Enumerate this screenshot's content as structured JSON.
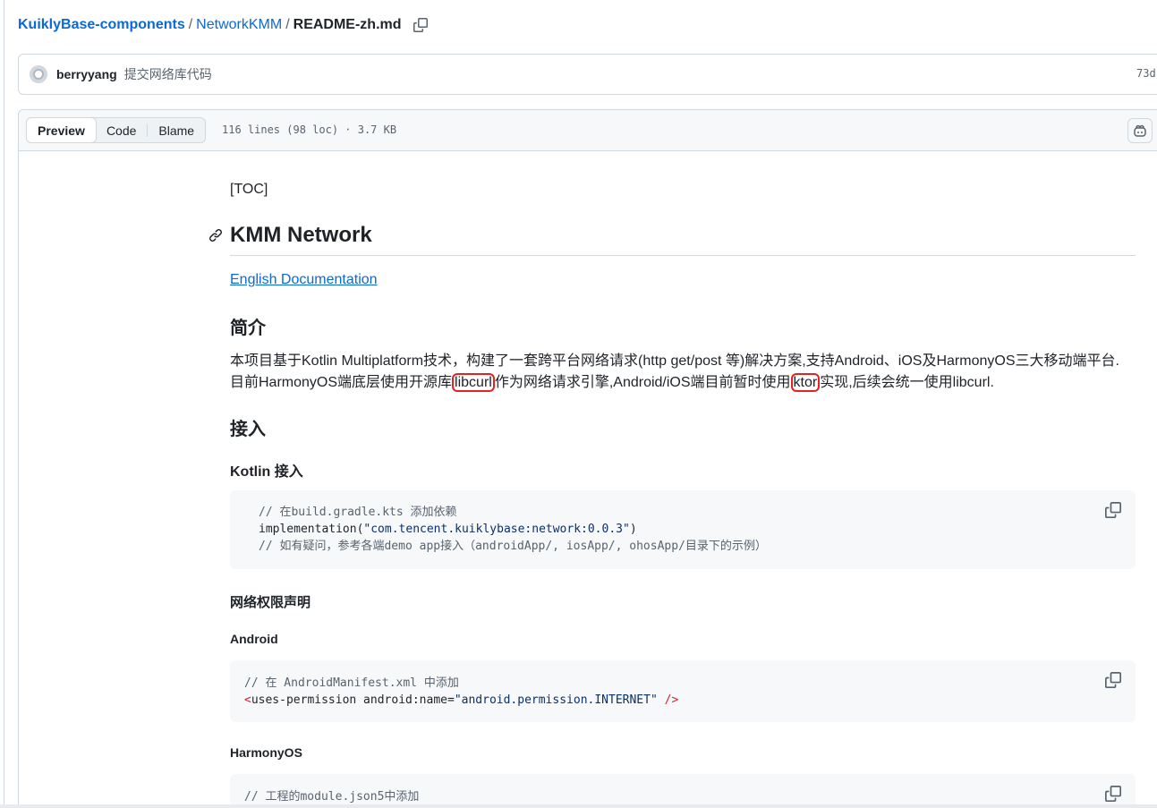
{
  "breadcrumb": {
    "repo": "KuiklyBase-components",
    "folder": "NetworkKMM",
    "file": "README-zh.md",
    "separator": "/"
  },
  "commit": {
    "author": "berryyang",
    "message": "提交网络库代码",
    "hash": "73d"
  },
  "file_header": {
    "tabs": [
      "Preview",
      "Code",
      "Blame"
    ],
    "active_tab": "Preview",
    "meta": "116 lines (98 loc) · 3.7 KB"
  },
  "readme": {
    "toc": "[TOC]",
    "title": "KMM Network",
    "english_link": "English Documentation",
    "intro_heading": "简介",
    "intro_part1": "本项目基于Kotlin Multiplatform技术，构建了一套跨平台网络请求(http get/post 等)解决方案,支持Android、iOS及HarmonyOS三大移动端平台. 目前HarmonyOS端底层使用开源库",
    "intro_hl1": "libcurl",
    "intro_part2": "作为网络请求引擎,Android/iOS端目前暂时使用",
    "intro_hl2": "ktor",
    "intro_part3": "实现,后续会统一使用libcurl.",
    "access_heading": "接入",
    "kotlin_heading": "Kotlin 接入",
    "kotlin_code": {
      "line1": "// 在build.gradle.kts 添加依赖",
      "line2_pre": "implementation(",
      "line2_str": "\"com.tencent.kuiklybase:network:0.0.3\"",
      "line2_post": ")",
      "line3": "// 如有疑问，参考各端demo app接入（androidApp/, iosApp/, ohosApp/目录下的示例）"
    },
    "permission_heading": "网络权限声明",
    "android_heading": "Android",
    "android_code": {
      "line1": "// 在 AndroidManifest.xml 中添加",
      "open": "<",
      "tag": "uses-permission",
      "attr": " android:name=",
      "value": "\"android.permission.INTERNET\"",
      "close": " />"
    },
    "harmony_heading": "HarmonyOS",
    "harmony_code": {
      "line1": "// 工程的module.json5中添加"
    }
  }
}
